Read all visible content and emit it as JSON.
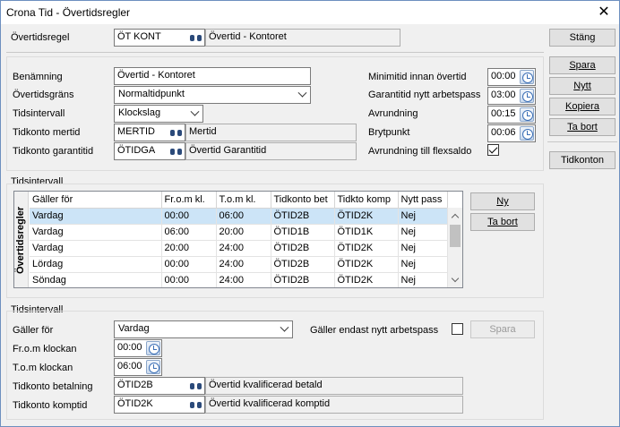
{
  "window": {
    "title": "Crona Tid - Övertidsregler"
  },
  "top": {
    "overtime_rule_label": "Övertidsregel",
    "overtime_rule_value": "ÖT KONT",
    "overtime_rule_desc": "Övertid - Kontoret",
    "close_button": "Stäng"
  },
  "side_buttons": {
    "save": "Spara",
    "new": "Nytt",
    "copy": "Kopiera",
    "delete": "Ta bort",
    "time_accounts": "Tidkonton"
  },
  "details": {
    "name_label": "Benämning",
    "name_value": "Övertid - Kontoret",
    "limit_label": "Övertidsgräns",
    "limit_value": "Normaltidpunkt",
    "interval_label": "Tidsintervall",
    "interval_value": "Klockslag",
    "account_more_label": "Tidkonto mertid",
    "account_more_value": "MERTID",
    "account_more_desc": "Mertid",
    "account_guarantee_label": "Tidkonto garantitid",
    "account_guarantee_value": "ÖTIDGA",
    "account_guarantee_desc": "Övertid Garantitid",
    "min_time_label": "Minimitid innan övertid",
    "min_time_value": "00:00",
    "guarantee_new_label": "Garantitid nytt arbetspass",
    "guarantee_new_value": "03:00",
    "rounding_label": "Avrundning",
    "rounding_value": "00:15",
    "break_point_label": "Brytpunkt",
    "break_point_value": "00:06",
    "round_flex_label": "Avrundning till flexsaldo",
    "round_flex_checked": true
  },
  "interval_table": {
    "group_label": "Tidsintervall",
    "side_label": "Övertidsregler",
    "columns": [
      "Gäller för",
      "Fr.o.m kl.",
      "T.o.m kl.",
      "Tidkonto bet",
      "Tidkto komp",
      "Nytt pass"
    ],
    "rows": [
      [
        "Vardag",
        "00:00",
        "06:00",
        "ÖTID2B",
        "ÖTID2K",
        "Nej"
      ],
      [
        "Vardag",
        "06:00",
        "20:00",
        "ÖTID1B",
        "ÖTID1K",
        "Nej"
      ],
      [
        "Vardag",
        "20:00",
        "24:00",
        "ÖTID2B",
        "ÖTID2K",
        "Nej"
      ],
      [
        "Lördag",
        "00:00",
        "24:00",
        "ÖTID2B",
        "ÖTID2K",
        "Nej"
      ],
      [
        "Söndag",
        "00:00",
        "24:00",
        "ÖTID2B",
        "ÖTID2K",
        "Nej"
      ]
    ],
    "new_button": "Ny",
    "delete_button": "Ta bort"
  },
  "interval_edit": {
    "group_label": "Tidsintervall",
    "applies_label": "Gäller för",
    "applies_value": "Vardag",
    "only_new_label": "Gäller endast nytt arbetspass",
    "only_new_checked": false,
    "save_button": "Spara",
    "from_label": "Fr.o.m klockan",
    "from_value": "00:00",
    "to_label": "T.o.m klockan",
    "to_value": "06:00",
    "pay_account_label": "Tidkonto betalning",
    "pay_account_value": "ÖTID2B",
    "pay_account_desc": "Övertid kvalificerad betald",
    "comp_account_label": "Tidkonto komptid",
    "comp_account_value": "ÖTID2K",
    "comp_account_desc": "Övertid kvalificerad komptid"
  }
}
